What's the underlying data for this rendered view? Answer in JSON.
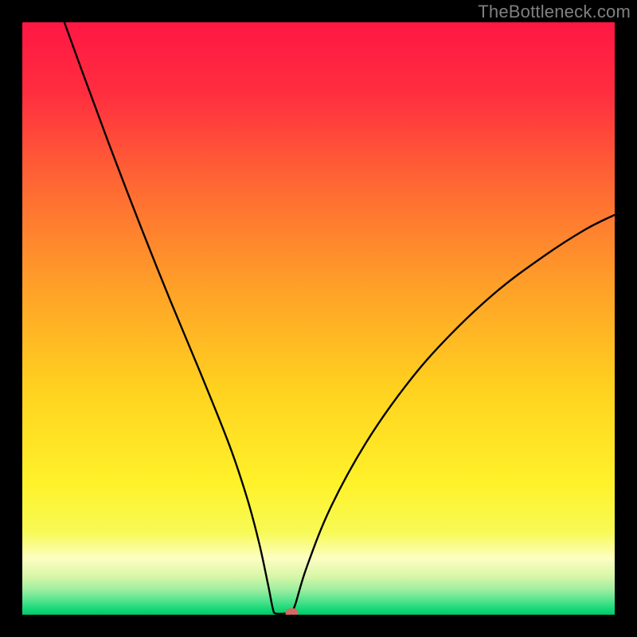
{
  "attribution": "TheBottleneck.com",
  "chart_data": {
    "type": "line",
    "title": "",
    "xlabel": "",
    "ylabel": "",
    "xlim": [
      0,
      100
    ],
    "ylim": [
      0,
      100
    ],
    "optimum_x_pct": 44,
    "curve_points": [
      {
        "x": 7.1,
        "y": 100.0
      },
      {
        "x": 10.0,
        "y": 92.0
      },
      {
        "x": 15.0,
        "y": 78.5
      },
      {
        "x": 20.0,
        "y": 65.5
      },
      {
        "x": 25.0,
        "y": 53.0
      },
      {
        "x": 30.0,
        "y": 41.0
      },
      {
        "x": 35.0,
        "y": 28.5
      },
      {
        "x": 38.0,
        "y": 19.5
      },
      {
        "x": 40.0,
        "y": 12.0
      },
      {
        "x": 41.5,
        "y": 5.0
      },
      {
        "x": 42.3,
        "y": 1.0
      },
      {
        "x": 42.8,
        "y": 0.2
      },
      {
        "x": 44.5,
        "y": 0.2
      },
      {
        "x": 45.2,
        "y": 0.2
      },
      {
        "x": 46.0,
        "y": 1.5
      },
      {
        "x": 48.0,
        "y": 8.0
      },
      {
        "x": 52.0,
        "y": 18.0
      },
      {
        "x": 58.0,
        "y": 29.0
      },
      {
        "x": 65.0,
        "y": 39.0
      },
      {
        "x": 72.0,
        "y": 47.0
      },
      {
        "x": 80.0,
        "y": 54.5
      },
      {
        "x": 88.0,
        "y": 60.5
      },
      {
        "x": 95.0,
        "y": 65.0
      },
      {
        "x": 100.0,
        "y": 67.5
      }
    ],
    "marker": {
      "x_pct": 45.5,
      "y_pct": 0.3
    },
    "gradient_stops": [
      {
        "offset": 0.0,
        "color": "#ff1744"
      },
      {
        "offset": 0.12,
        "color": "#ff2e3f"
      },
      {
        "offset": 0.28,
        "color": "#ff6a33"
      },
      {
        "offset": 0.45,
        "color": "#ffa128"
      },
      {
        "offset": 0.62,
        "color": "#ffd21f"
      },
      {
        "offset": 0.78,
        "color": "#fff22a"
      },
      {
        "offset": 0.86,
        "color": "#f7fa55"
      },
      {
        "offset": 0.905,
        "color": "#fdfec2"
      },
      {
        "offset": 0.935,
        "color": "#d8f7a8"
      },
      {
        "offset": 0.958,
        "color": "#9ceea0"
      },
      {
        "offset": 0.975,
        "color": "#57e48f"
      },
      {
        "offset": 0.99,
        "color": "#18d977"
      },
      {
        "offset": 1.0,
        "color": "#00c76a"
      }
    ],
    "marker_color": "#d46a5f",
    "curve_color": "#000000"
  }
}
